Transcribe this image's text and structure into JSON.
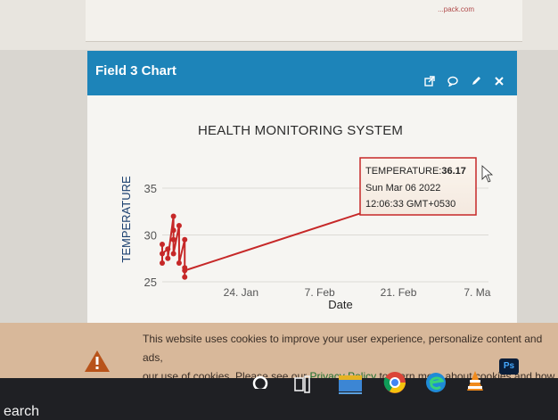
{
  "top_snippet": "...pack.com",
  "widget": {
    "title": "Field 3 Chart",
    "icons": [
      "external-link-icon",
      "comment-icon",
      "pencil-icon",
      "close-icon"
    ]
  },
  "chart_data": {
    "type": "line",
    "title": "HEALTH MONITORING SYSTEM",
    "xlabel": "Date",
    "ylabel": "TEMPERATURE",
    "x_ticks": [
      "24. Jan",
      "7. Feb",
      "21. Feb",
      "7. Ma"
    ],
    "y_ticks": [
      25,
      30,
      35
    ],
    "ylim": [
      25,
      37
    ],
    "grid": true,
    "series": [
      {
        "color": "#c62828",
        "points": [
          [
            "2022-01-10",
            27.0
          ],
          [
            "2022-01-10",
            29.0
          ],
          [
            "2022-01-10",
            28.0
          ],
          [
            "2022-01-11",
            28.5
          ],
          [
            "2022-01-11",
            27.5
          ],
          [
            "2022-01-12",
            32.0
          ],
          [
            "2022-01-12",
            30.5
          ],
          [
            "2022-01-12",
            29.5
          ],
          [
            "2022-01-12",
            28.0
          ],
          [
            "2022-01-13",
            31.0
          ],
          [
            "2022-01-13",
            27.0
          ],
          [
            "2022-01-14",
            29.5
          ],
          [
            "2022-01-14",
            26.5
          ],
          [
            "2022-01-14",
            25.5
          ],
          [
            "2022-01-14",
            26.2
          ],
          [
            "2022-03-06",
            36.17
          ],
          [
            "2022-03-06",
            35.5
          ]
        ]
      }
    ],
    "tooltip": {
      "label": "TEMPERATURE:",
      "value": "36.17",
      "date": "Sun Mar 06 2022",
      "time": "12:06:33 GMT+0530"
    }
  },
  "cookie": {
    "text1": "This website uses cookies to improve your user experience, personalize content and ads,",
    "text2": "our use of cookies. Please see our ",
    "link": "Privacy Policy",
    "text3": " to learn more about cookies and how to"
  },
  "taskbar": {
    "search_text": "earch",
    "ps_label": "Ps"
  }
}
